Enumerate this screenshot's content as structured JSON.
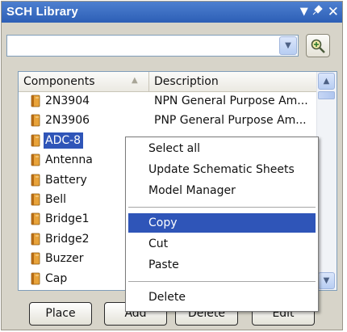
{
  "panel": {
    "title": "SCH Library"
  },
  "title_icons": [
    "dropdown-arrow-icon",
    "pin-icon",
    "close-icon"
  ],
  "filter": {
    "value": ""
  },
  "list": {
    "columns": [
      "Components",
      "Description"
    ],
    "rows": [
      {
        "name": "2N3904",
        "description": "NPN General Purpose Am..."
      },
      {
        "name": "2N3906",
        "description": "PNP General Purpose Am..."
      },
      {
        "name": "ADC-8",
        "description": "",
        "selected": true
      },
      {
        "name": "Antenna",
        "description": ""
      },
      {
        "name": "Battery",
        "description": ""
      },
      {
        "name": "Bell",
        "description": ""
      },
      {
        "name": "Bridge1",
        "description": ""
      },
      {
        "name": "Bridge2",
        "description": ""
      },
      {
        "name": "Buzzer",
        "description": ""
      },
      {
        "name": "Cap",
        "description": ""
      }
    ]
  },
  "buttons": {
    "place": "Place",
    "add": "Add",
    "delete": "Delete",
    "edit": "Edit"
  },
  "context_menu": {
    "items": [
      {
        "label": "Select all"
      },
      {
        "label": "Update Schematic Sheets"
      },
      {
        "label": "Model Manager"
      },
      {
        "label": "Copy",
        "active": true
      },
      {
        "label": "Cut"
      },
      {
        "label": "Paste"
      },
      {
        "label": "Delete"
      }
    ]
  },
  "colors": {
    "titlebar": "#3a6ac4",
    "selection": "#2f55b8",
    "panel": "#d7d4c9"
  }
}
